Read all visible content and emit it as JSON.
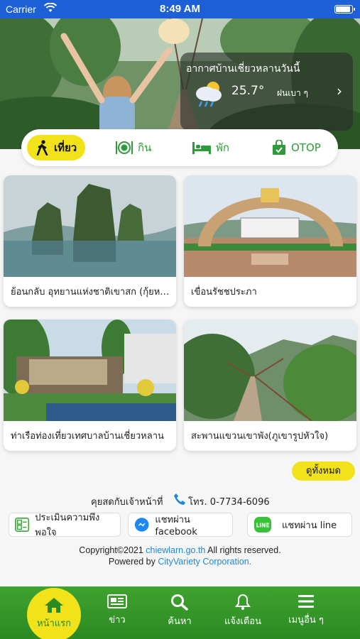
{
  "status_bar": {
    "carrier": "Carrier",
    "time": "8:49 AM"
  },
  "weather": {
    "title": "อากาศบ้านเชี่ยวหลานวันนี้",
    "temperature": "25.7°",
    "description": "ฝนเบา ๆ",
    "icon": "rain-cloud-icon"
  },
  "categories": [
    {
      "label": "เที่ยว",
      "icon": "walking-icon",
      "active": true
    },
    {
      "label": "กิน",
      "icon": "dining-icon",
      "active": false
    },
    {
      "label": "พัก",
      "icon": "bed-icon",
      "active": false
    },
    {
      "label": "OTOP",
      "icon": "shopping-bag-icon",
      "active": false
    }
  ],
  "places": [
    {
      "title": "ย้อนกลับ อุทยานแห่งชาติเขาสก (กุ้ยหลินเมืองไทย)"
    },
    {
      "title": "เขื่อนรัชชประภา"
    },
    {
      "title": "ท่าเรือท่องเที่ยวเทศบาลบ้านเชี่ยวหลาน"
    },
    {
      "title": "สะพานแขวนเขาพัง(ภูเขารูปหัวใจ)"
    }
  ],
  "see_all": "ดูทั้งหมด",
  "contact": {
    "label": "คุยสดกับเจ้าหน้าที่",
    "phone": "โทร. 0-7734-6096"
  },
  "actions": {
    "survey": "ประเมินความพึงพอใจ",
    "facebook": "แชทผ่าน facebook",
    "line": "แชทผ่าน line"
  },
  "footer": {
    "copyright_prefix": "Copyright©2021",
    "site": "chiewlarn.go.th",
    "rights": "All rights reserved.",
    "powered_prefix": "Powered by",
    "company": "CityVariety Corporation."
  },
  "tabs": [
    {
      "label": "หน้าแรก",
      "icon": "home-icon"
    },
    {
      "label": "ข่าว",
      "icon": "newspaper-icon"
    },
    {
      "label": "ค้นหา",
      "icon": "search-icon"
    },
    {
      "label": "แจ้งเตือน",
      "icon": "bell-icon"
    },
    {
      "label": "เมนูอื่น ๆ",
      "icon": "menu-icon"
    }
  ],
  "colors": {
    "accent_yellow": "#f2e21a",
    "brand_green": "#2b8a22",
    "link_blue": "#1e88d8",
    "status_blue": "#1c5fd6"
  }
}
